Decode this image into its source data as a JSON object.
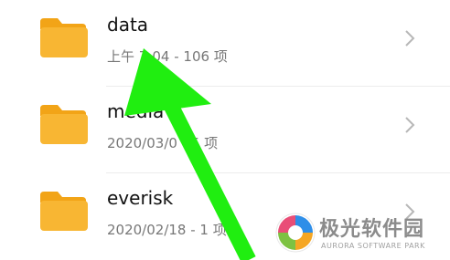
{
  "colors": {
    "folder": "#f8b633",
    "folder_tab": "#f2a417",
    "chevron": "#b7b7b7",
    "arrow": "#20ee10",
    "watermark_text": "#8b8b8b"
  },
  "files": [
    {
      "name": "data",
      "meta": "上午 7:04  - 106 项",
      "icon": "folder-icon"
    },
    {
      "name": "media",
      "meta": "2020/03/0  - 5 项",
      "icon": "folder-icon"
    },
    {
      "name": "everisk",
      "meta": "2020/02/18 - 1 项",
      "icon": "folder-icon"
    }
  ],
  "watermark": {
    "title": "极光软件园",
    "subtitle": "AURORA SOFTWARE PARK"
  }
}
